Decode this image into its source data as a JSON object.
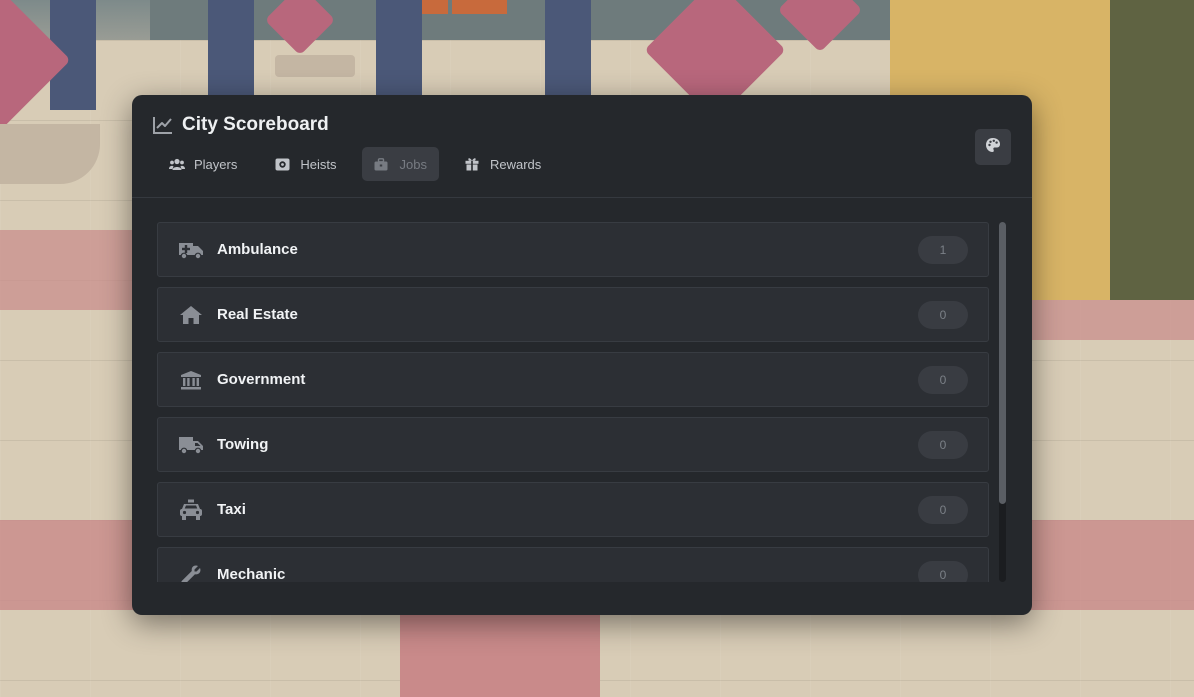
{
  "app": {
    "title": "City Scoreboard"
  },
  "tabs": [
    {
      "label": "Players",
      "icon": "users-icon",
      "active": false
    },
    {
      "label": "Heists",
      "icon": "vault-icon",
      "active": false
    },
    {
      "label": "Jobs",
      "icon": "briefcase-icon",
      "active": true
    },
    {
      "label": "Rewards",
      "icon": "gift-icon",
      "active": false
    }
  ],
  "theme_button": {
    "icon": "palette-icon"
  },
  "jobs": [
    {
      "label": "Ambulance",
      "count": "1",
      "icon": "ambulance-icon"
    },
    {
      "label": "Real Estate",
      "count": "0",
      "icon": "house-icon"
    },
    {
      "label": "Government",
      "count": "0",
      "icon": "landmark-icon"
    },
    {
      "label": "Towing",
      "count": "0",
      "icon": "truck-icon"
    },
    {
      "label": "Taxi",
      "count": "0",
      "icon": "taxi-icon"
    },
    {
      "label": "Mechanic",
      "count": "0",
      "icon": "wrench-icon"
    }
  ],
  "colors": {
    "panel_bg": "#25282c",
    "row_bg": "#2c2f34",
    "active_tab_bg": "#3a3d43",
    "icon_gray": "#8a8e95"
  }
}
